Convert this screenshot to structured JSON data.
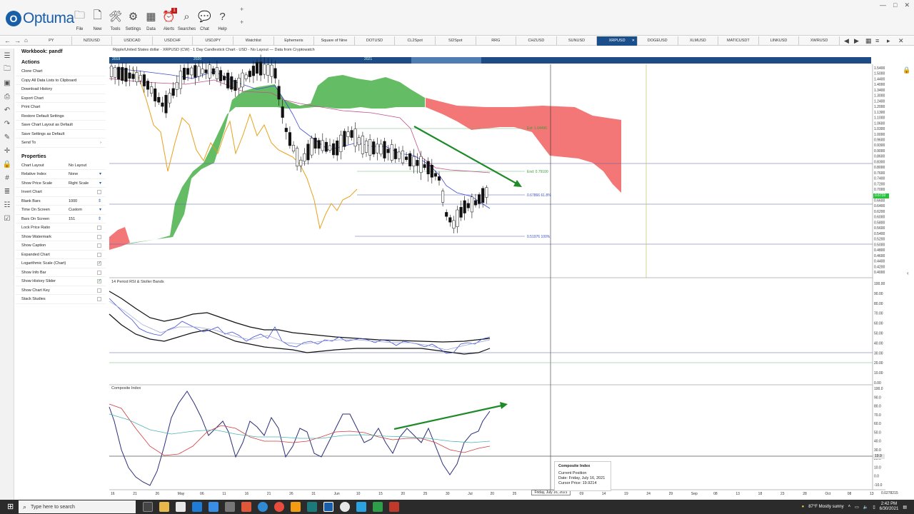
{
  "app": {
    "name": "Optuma",
    "logo_letter": "O"
  },
  "toolbar": {
    "buttons": [
      {
        "id": "file",
        "label": "File",
        "icon": "folder-icon",
        "glyph": "🗀"
      },
      {
        "id": "new",
        "label": "New",
        "icon": "new-document-icon",
        "glyph": "🗋"
      },
      {
        "id": "tools",
        "label": "Tools",
        "icon": "tools-icon",
        "glyph": "🛠"
      },
      {
        "id": "settings",
        "label": "Settings",
        "icon": "gear-icon",
        "glyph": "⚙"
      },
      {
        "id": "data",
        "label": "Data",
        "icon": "data-icon",
        "glyph": "▦"
      },
      {
        "id": "alerts",
        "label": "Alerts",
        "icon": "alarm-clock-icon",
        "glyph": "⏰",
        "badge": "1"
      },
      {
        "id": "searches",
        "label": "Searches",
        "icon": "search-icon",
        "glyph": "⌕"
      },
      {
        "id": "chat",
        "label": "Chat",
        "icon": "chat-icon",
        "glyph": "💬"
      },
      {
        "id": "help",
        "label": "Help",
        "icon": "help-icon",
        "glyph": "?"
      }
    ]
  },
  "tabs": [
    "PY",
    "NZDUSD",
    "USDCAD",
    "USDCHF",
    "USDJPY",
    "Watchlist",
    "Ephemeris",
    "Square of Nine",
    "DOTUSD",
    "CL2Spot",
    "SI2Spot",
    "RRG",
    "CHZUSD",
    "SUNUSD",
    "XRPUSD",
    "DOGEUSD",
    "XLMUSD",
    "MATICUSDT",
    "LINKUSD",
    "XWRUSD"
  ],
  "active_tab": "XRPUSD",
  "workbook": {
    "title": "Workbook: pandf"
  },
  "actions": {
    "title": "Actions",
    "items": [
      "Clone Chart",
      "Copy All Data Lists to Clipboard",
      "Download History",
      "Export Chart",
      "Print Chart",
      "Restore Default Settings",
      "Save Chart Layout as Default",
      "Save Settings as Default",
      "Send To"
    ]
  },
  "properties": {
    "title": "Properties",
    "rows": [
      {
        "name": "Chart Layout",
        "value": "No Layout"
      },
      {
        "name": "Relative Index",
        "value": "None"
      },
      {
        "name": "Show Price Scale",
        "value": "Right Scale"
      },
      {
        "name": "Invert Chart",
        "value": ""
      },
      {
        "name": "Blank Bars",
        "value": "1000"
      },
      {
        "name": "Time On Screen",
        "value": "Custom"
      },
      {
        "name": "Bars On Screen",
        "value": "151"
      },
      {
        "name": "Lock Price Ratio",
        "value": ""
      },
      {
        "name": "Show Watermark",
        "value": ""
      },
      {
        "name": "Show Caption",
        "value": ""
      },
      {
        "name": "Expanded Chart",
        "value": ""
      },
      {
        "name": "Logarithmic Scale (Chart)",
        "value": ""
      },
      {
        "name": "Show Info Bar",
        "value": ""
      },
      {
        "name": "Show History Slider",
        "value": ""
      },
      {
        "name": "Show Chart Key",
        "value": ""
      },
      {
        "name": "Stack Studies",
        "value": ""
      }
    ],
    "checked": [
      "Logarithmic Scale (Chart)",
      "Show History Slider"
    ]
  },
  "chart": {
    "title": "Ripple/United States dollar - XRPUSD (CW) - 1 Day Candlestick Chart - USD - No Layout — Data from Cryptowatch",
    "slider_years": [
      "2019",
      "2020",
      "2021"
    ],
    "price_axis": [
      "1.5400",
      "1.5000",
      "1.4400",
      "1.4000",
      "1.3400",
      "1.3000",
      "1.2400",
      "1.2000",
      "1.1300",
      "1.1000",
      "1.0600",
      "1.0300",
      "1.0000",
      "0.9600",
      "0.9300",
      "0.9000",
      "0.8600",
      "0.8300",
      "0.8000",
      "0.7600",
      "0.7400",
      "0.7200",
      "0.7000",
      "0.6733",
      "0.6600",
      "0.6400",
      "0.6200",
      "0.6000",
      "0.5800",
      "0.5600",
      "0.5400",
      "0.5200",
      "0.5000",
      "0.4800",
      "0.4600",
      "0.4400",
      "0.4200",
      "0.4000"
    ],
    "last_price": "0.6733",
    "annotations": [
      {
        "text": "Ext: 1.04496"
      },
      {
        "text": "End: 0.79100"
      },
      {
        "text": "0.67866   61.8%"
      },
      {
        "text": "0.51976   100%"
      }
    ],
    "rsi_title": "14 Period RSI & Stoller Bands",
    "rsi_axis": [
      "100.00",
      "90.00",
      "80.00",
      "70.00",
      "60.00",
      "50.00",
      "40.00",
      "30.00",
      "20.00",
      "10.00",
      "0.00"
    ],
    "ci_title": "Composite Index",
    "ci_axis": [
      "100.0",
      "90.0",
      "80.0",
      "70.0",
      "60.0",
      "50.0",
      "40.0",
      "30.0",
      "20.0",
      "10.0",
      "0.0",
      "-10.0"
    ],
    "ci_marker": "19.9",
    "date_axis": [
      "16",
      "21",
      "26",
      "May",
      "06",
      "11",
      "16",
      "21",
      "26",
      "31",
      "Jun",
      "10",
      "15",
      "20",
      "25",
      "30",
      "Jul",
      "20",
      "25",
      "30",
      "Aug",
      "09",
      "14",
      "19",
      "24",
      "29",
      "Sep",
      "08",
      "13",
      "18",
      "23",
      "28",
      "Oct",
      "08",
      "13"
    ],
    "cursor_date_label": "Friday, July 16, 2021",
    "bottom_right_value": "0.0278215"
  },
  "tooltip": {
    "title": "Composite Index",
    "line1": "Current Position",
    "line2": "Date: Friday, July 16, 2021",
    "line3": "Cursor Price: 19.9214"
  },
  "taskbar": {
    "search_placeholder": "Type here to search",
    "weather": "87°F  Mostly sunny",
    "time": "2:42 PM",
    "date": "6/30/2021"
  },
  "colors": {
    "accent": "#1a5ea8",
    "active_tab": "#1b4f8c",
    "cloud_green": "#4caf50",
    "cloud_red": "#f36b6b",
    "arrow_green": "#1f8a2a"
  }
}
